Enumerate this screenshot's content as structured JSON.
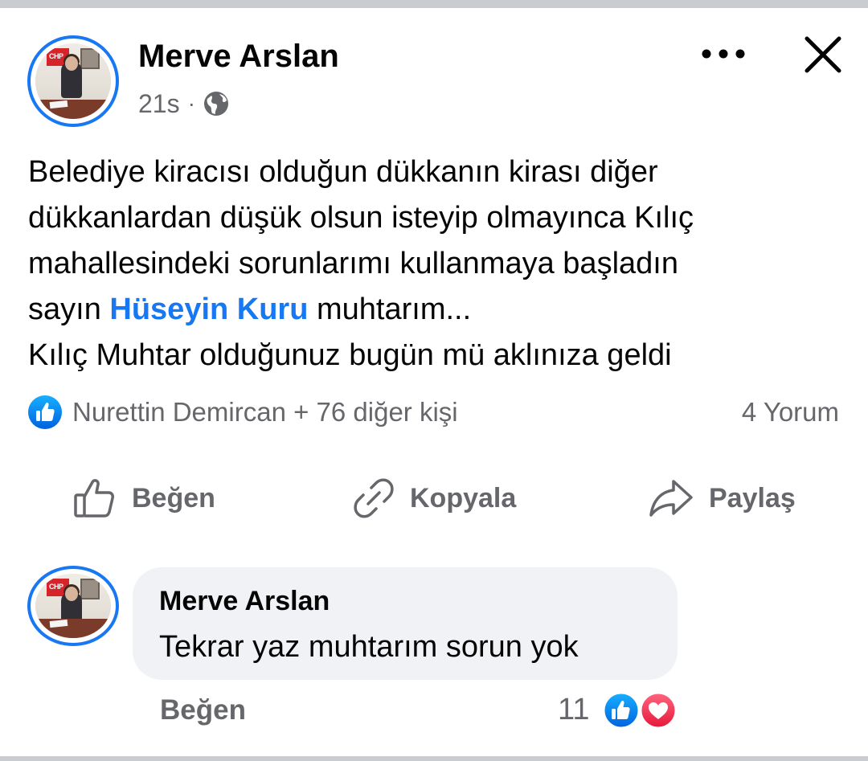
{
  "post": {
    "author": "Merve Arslan",
    "time": "21s",
    "separator": "·",
    "privacy_icon": "globe-icon",
    "more_icon": "more-icon",
    "close_icon": "close-icon",
    "text_lines": [
      "Belediye kiracısı olduğun dükkanın kirası diğer",
      "dükkanlardan düşük olsun isteyip olmayınca Kılıç",
      "mahallesindeki sorunlarımı kullanmaya başladın"
    ],
    "line4_prefix": "sayın ",
    "mention": "Hüseyin Kuru",
    "line4_suffix": " muhtarım...",
    "line5": "Kılıç Muhtar olduğunuz bugün mü aklınıza geldi",
    "avatar_badge_text": "CHP"
  },
  "reactions": {
    "summary": "Nurettin Demircan + 76 diğer kişi",
    "comments": "4 Yorum"
  },
  "actions": {
    "like": "Beğen",
    "copy": "Kopyala",
    "share": "Paylaş"
  },
  "comment": {
    "author": "Merve Arslan",
    "text": "Tekrar yaz muhtarım sorun yok",
    "like_label": "Beğen",
    "reaction_count": "11",
    "avatar_badge_text": "CHP"
  },
  "colors": {
    "accent": "#1877f2",
    "love": "#f33e58",
    "secondary_text": "#65676b",
    "bubble": "#f0f2f5"
  }
}
